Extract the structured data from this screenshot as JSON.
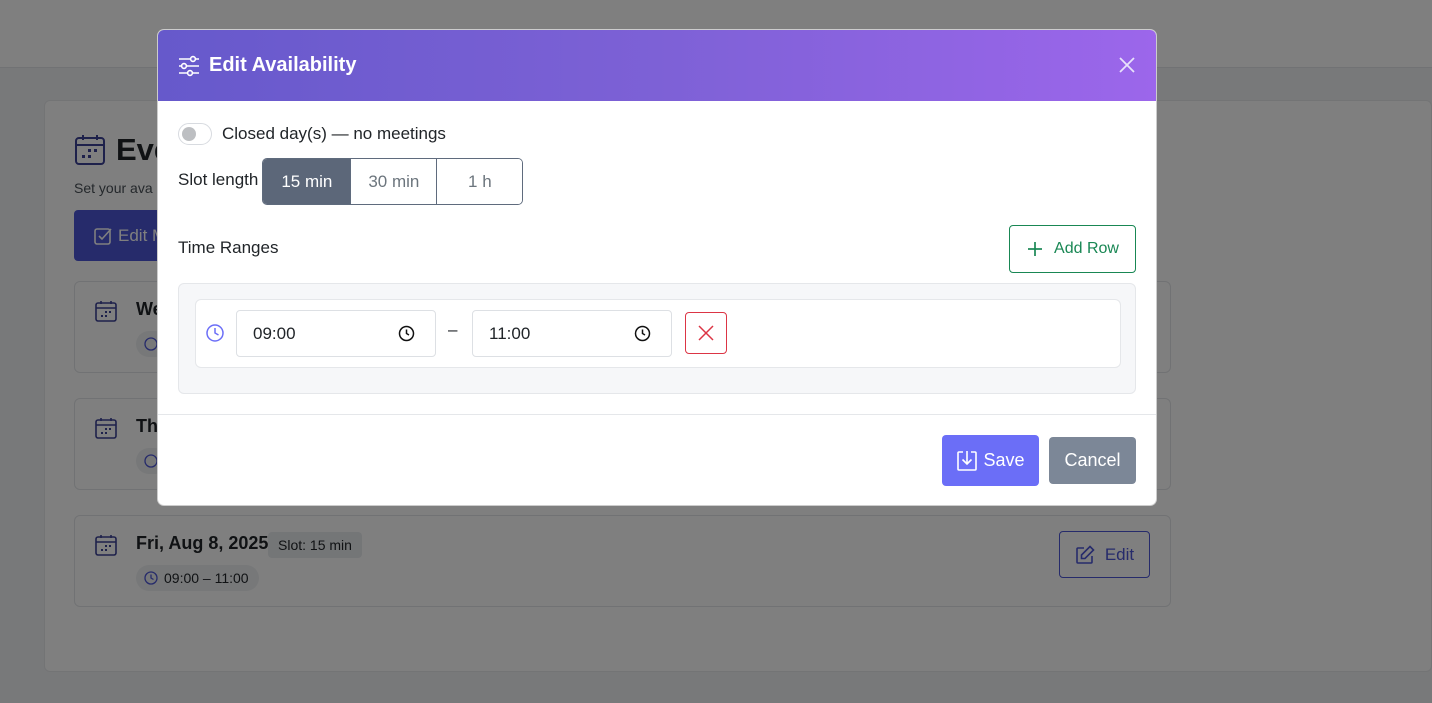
{
  "page": {
    "title": "Eve",
    "subtitle": "Set your ava",
    "edit_many_label": "Edit M",
    "days": [
      {
        "label": "We",
        "slot": "",
        "range": ""
      },
      {
        "label": "Th",
        "slot": "",
        "range": ""
      },
      {
        "label": "Fri, Aug 8, 2025",
        "slot": "Slot: 15 min",
        "range": "09:00 – 11:00",
        "edit_label": "Edit"
      }
    ]
  },
  "modal": {
    "title": "Edit Availability",
    "closed_label": "Closed day(s) — no meetings",
    "closed_on": false,
    "slot_label": "Slot length",
    "slot_options": [
      "15 min",
      "30 min",
      "1 h"
    ],
    "slot_selected": "15 min",
    "ranges_title": "Time Ranges",
    "add_row_label": "Add Row",
    "ranges": [
      {
        "start": "09:00",
        "end": "11:00"
      }
    ],
    "range_separator": "–",
    "save_label": "Save",
    "cancel_label": "Cancel"
  },
  "colors": {
    "header_gradient_start": "#6659cb",
    "header_gradient_end": "#9c66eb",
    "primary": "#4d56d6",
    "save": "#6b6ef7",
    "success": "#198754",
    "danger": "#dc3545",
    "slot_active": "#5c6779",
    "cancel": "#7c8797"
  },
  "icons": {
    "header": "sliders-icon",
    "close": "close-icon",
    "add": "plus-icon",
    "time": "clock-icon",
    "remove": "x-icon",
    "save": "download-box-icon",
    "calendar": "calendar-icon",
    "edit": "pencil-square-icon"
  }
}
